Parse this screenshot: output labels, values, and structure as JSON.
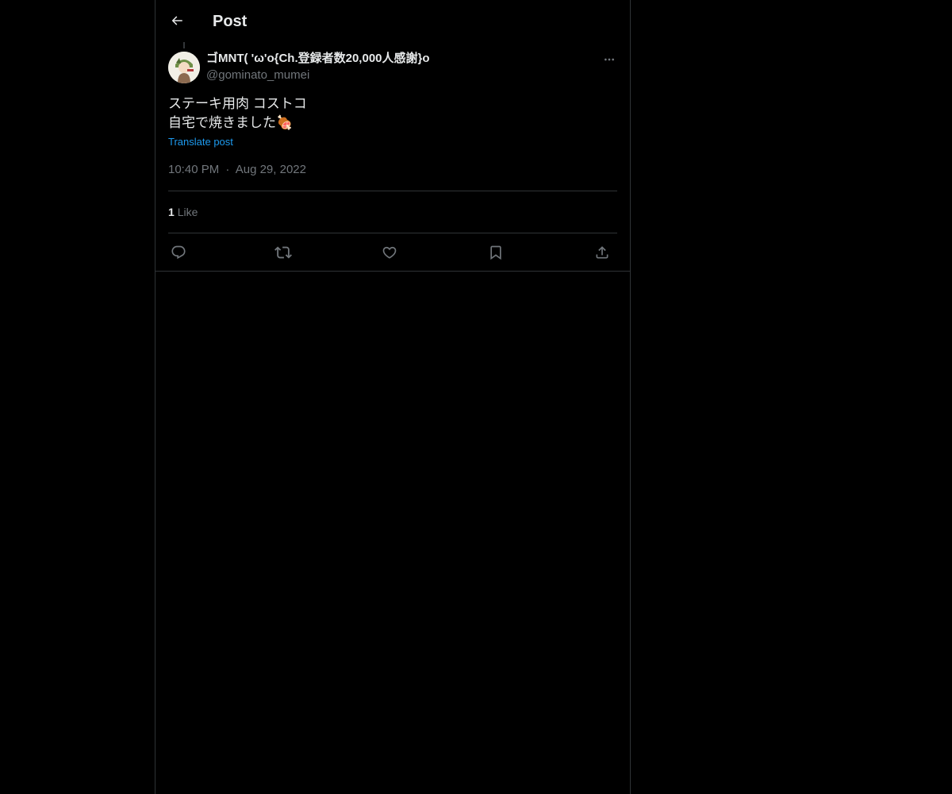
{
  "header": {
    "title": "Post",
    "back_icon": "arrow-left-icon"
  },
  "post": {
    "author": {
      "display_name": "ゴMNT( 'ω'o{Ch.登録者数20,000人感謝}o",
      "handle": "@gominato_mumei"
    },
    "text_line_1": "ステーキ用肉 コストコ",
    "text_line_2": "自宅で焼きました🍖",
    "translate_label": "Translate post",
    "time": "10:40 PM",
    "separator": "·",
    "date": "Aug 29, 2022",
    "likes_count": "1",
    "likes_label": "Like"
  },
  "actions": [
    {
      "icon": "reply-icon"
    },
    {
      "icon": "repost-icon"
    },
    {
      "icon": "like-icon"
    },
    {
      "icon": "bookmark-icon"
    },
    {
      "icon": "share-icon"
    }
  ],
  "colors": {
    "background": "#000000",
    "text": "#e7e9ea",
    "muted": "#71767b",
    "accent": "#1d9bf0",
    "border": "#2f3336"
  }
}
